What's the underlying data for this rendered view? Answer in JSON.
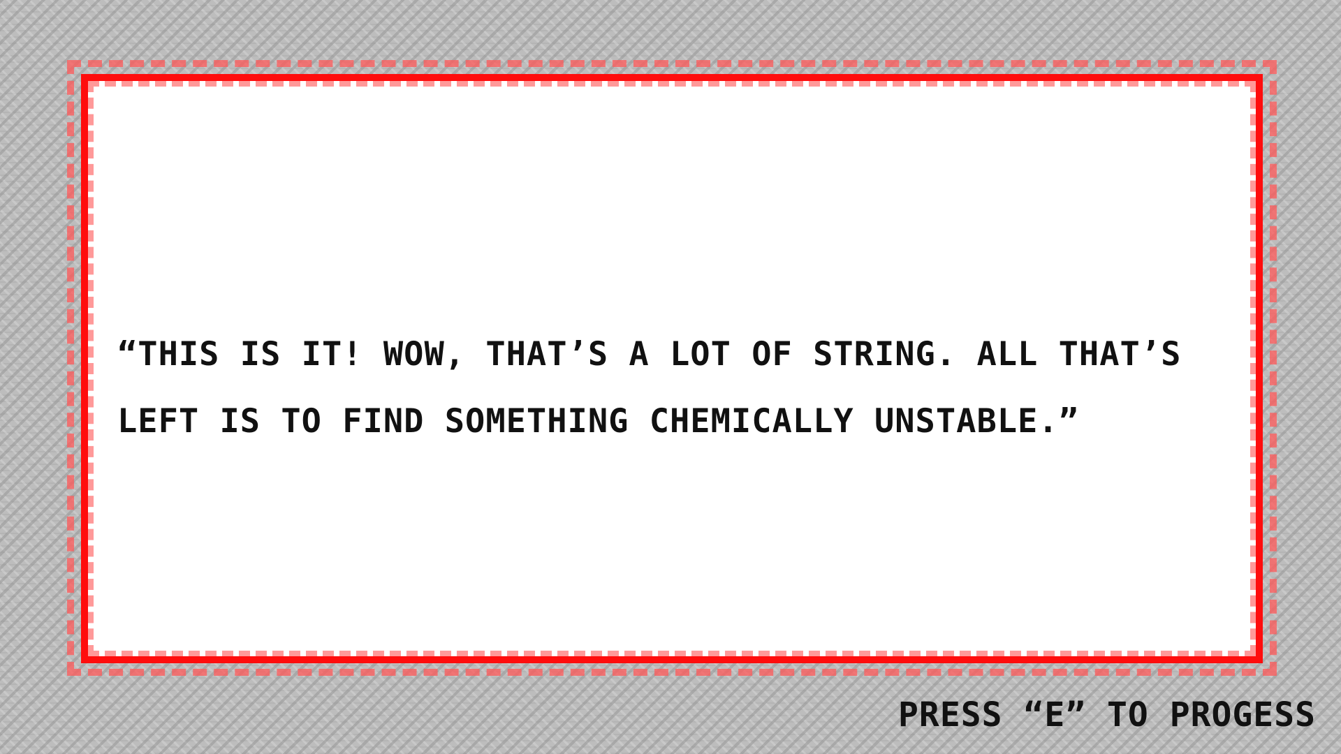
{
  "dialog": {
    "text": "“This is it! Wow, that’s a lot of string. All that’s left is to find something chemically unstable.”"
  },
  "prompt": {
    "text": "Press “E” to progess"
  },
  "colors": {
    "border": "#ff0d0d",
    "border_speckle": "#ff5a5a",
    "dialog_background": "#ffffff",
    "text": "#111111",
    "backdrop": "#bdbdbd"
  }
}
